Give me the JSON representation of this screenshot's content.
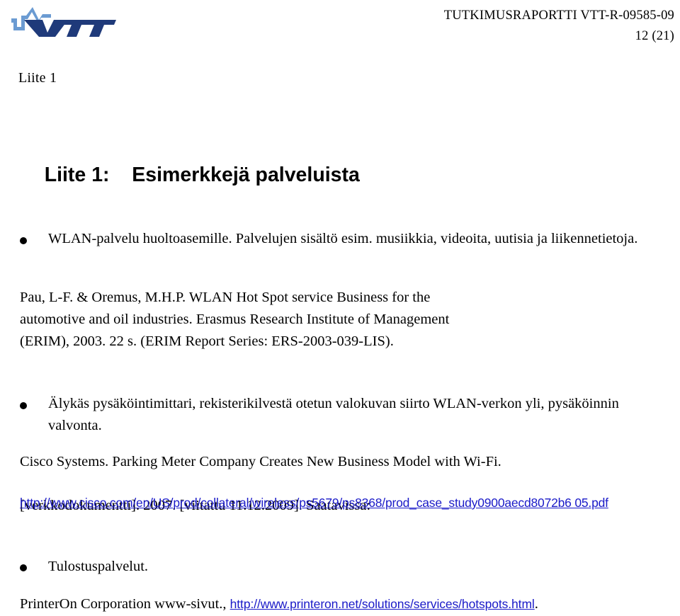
{
  "header": {
    "report_id": "TUTKIMUSRAPORTTI VTT-R-09585-09",
    "page_number": "12 (21)",
    "logo_alt": "VTT",
    "appendix_label": "Liite 1"
  },
  "title": {
    "number": "Liite 1:",
    "text": "Esimerkkejä palveluista"
  },
  "items": [
    {
      "bullet": "WLAN-palvelu huoltoasemille. Palvelujen sisältö esim. musiikkia, videoita, uutisia ja liikennetietoja.",
      "reference_lines": [
        "Pau, L-F. & Oremus, M.H.P. WLAN Hot Spot service Business for the",
        "automotive and oil industries. Erasmus Research Institute of Management",
        "(ERIM), 2003. 22 s. (ERIM Report Series: ERS-2003-039-LIS)."
      ]
    },
    {
      "bullet": "Älykäs pysäköintimittari, rekisterikilvestä otetun valokuvan siirto WLAN-verkon yli, pysäköinnin valvonta.",
      "reference_line1": "Cisco Systems. Parking Meter Company Creates New Business Model with Wi-Fi.",
      "reference_line2": "[verkkodokumentti]. 2007. [viitattu 11.12.2009]. Saatavissa:",
      "url": "http://www.cisco.com/en/US/prod/collateral/wireless/ps5679/ps8368/prod_case_study0900aecd8072b6 05.pdf"
    },
    {
      "bullet": "Tulostuspalvelut.",
      "reference_prefix": "PrinterOn Corporation www-sivut., ",
      "url": "http://www.printeron.net/solutions/services/hotspots.html",
      "reference_suffix": "."
    }
  ],
  "colors": {
    "link": "#1A1AC8",
    "logo_dark": "#1F3A7A",
    "logo_light": "#6B9BD2",
    "text": "#000000"
  }
}
